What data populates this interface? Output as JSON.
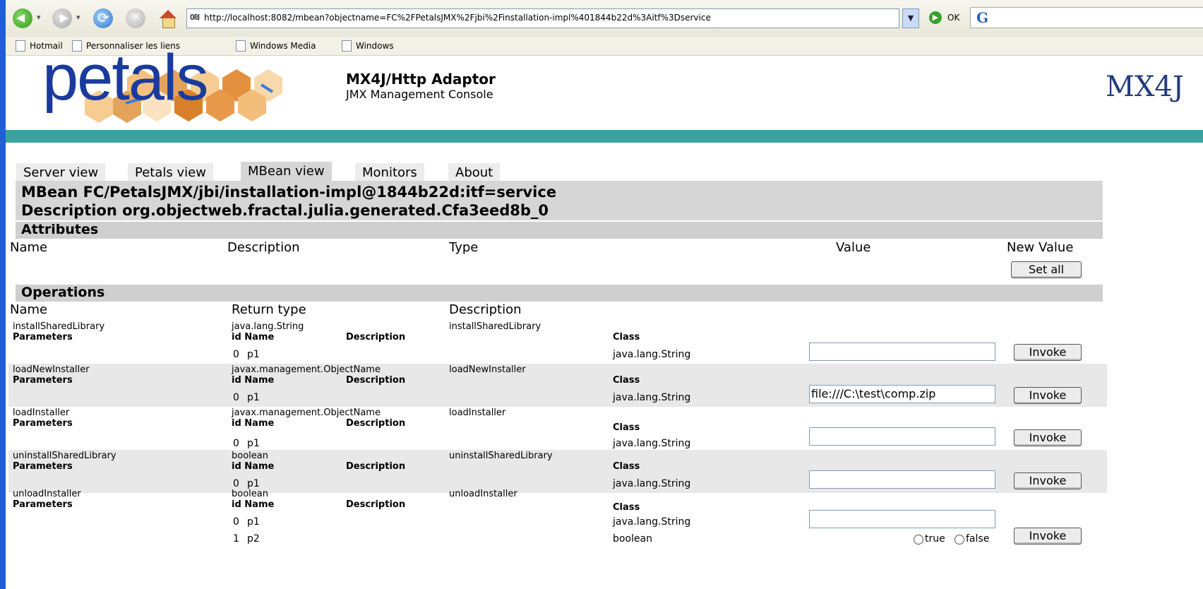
{
  "browser": {
    "address": "http://localhost:8082/mbean?objectname=FC%2FPetalsJMX%2Fjbi%2Finstallation-impl%401844b22d%3Aitf%3Dservice",
    "go_label": "OK",
    "links": [
      "Hotmail",
      "Personnaliser les liens",
      "Windows Media",
      "Windows"
    ]
  },
  "header": {
    "logo_text": "petals",
    "title": "MX4J/Http Adaptor",
    "subtitle": "JMX Management Console",
    "mx4j_logo": "MX4J",
    "teal": "#3da19e"
  },
  "tabs": [
    "Server view",
    "Petals view",
    "MBean view",
    "Monitors",
    "About"
  ],
  "mbean": {
    "name": "MBean FC/PetalsJMX/jbi/installation-impl@1844b22d:itf=service",
    "description": "Description org.objectweb.fractal.julia.generated.Cfa3eed8b_0"
  },
  "attributes": {
    "title": "Attributes",
    "columns": [
      "Name",
      "Description",
      "Type",
      "Value",
      "New Value"
    ],
    "set_all_label": "Set all"
  },
  "operations": {
    "title": "Operations",
    "columns": [
      "Name",
      "Return type",
      "Description"
    ],
    "params_label": "Parameters",
    "id_name_label": "id Name",
    "description_label": "Description",
    "class_label": "Class",
    "invoke_label": "Invoke",
    "true_label": "true",
    "false_label": "false",
    "rows": [
      {
        "name": "installSharedLibrary",
        "return_type": "java.lang.String",
        "description": "installSharedLibrary",
        "params": [
          {
            "id": "0",
            "name": "p1",
            "class": "java.lang.String",
            "value": ""
          }
        ]
      },
      {
        "name": "loadNewInstaller",
        "return_type": "javax.management.ObjectName",
        "description": "loadNewInstaller",
        "params": [
          {
            "id": "0",
            "name": "p1",
            "class": "java.lang.String",
            "value": "file:///C:\\test\\comp.zip"
          }
        ]
      },
      {
        "name": "loadInstaller",
        "return_type": "javax.management.ObjectName",
        "description": "loadInstaller",
        "params": [
          {
            "id": "0",
            "name": "p1",
            "class": "java.lang.String",
            "value": ""
          }
        ]
      },
      {
        "name": "uninstallSharedLibrary",
        "return_type": "boolean",
        "description": "uninstallSharedLibrary",
        "params": [
          {
            "id": "0",
            "name": "p1",
            "class": "java.lang.String",
            "value": ""
          }
        ]
      },
      {
        "name": "unloadInstaller",
        "return_type": "boolean",
        "description": "unloadInstaller",
        "params": [
          {
            "id": "0",
            "name": "p1",
            "class": "java.lang.String",
            "value": ""
          },
          {
            "id": "1",
            "name": "p2",
            "class": "boolean",
            "value": ""
          }
        ]
      }
    ]
  }
}
